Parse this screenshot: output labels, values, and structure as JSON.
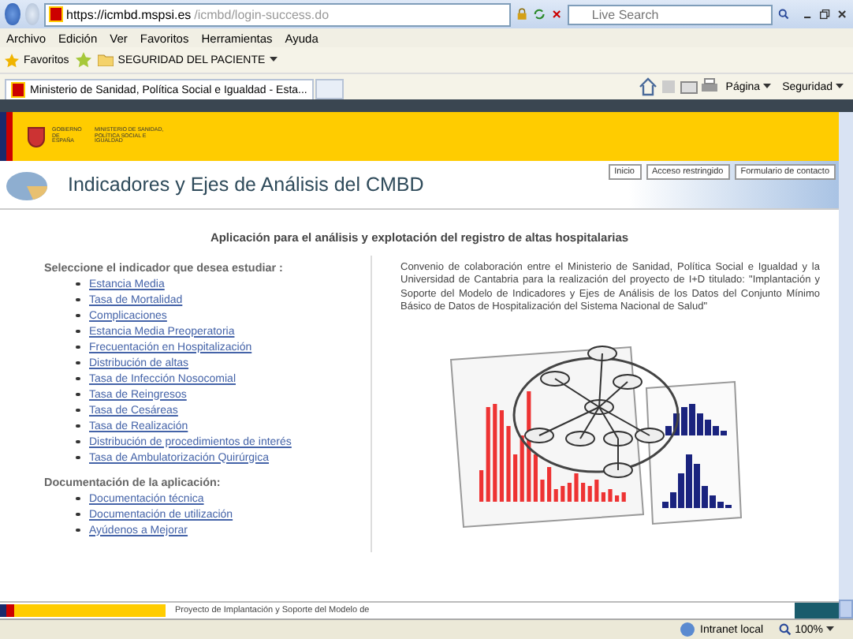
{
  "browser": {
    "url_host": "https://icmbd.mspsi.es",
    "url_path": "/icmbd/login-success.do",
    "search_placeholder": "Live Search",
    "menu": [
      "Archivo",
      "Edición",
      "Ver",
      "Favoritos",
      "Herramientas",
      "Ayuda"
    ],
    "favorites_label": "Favoritos",
    "favorites_folder": "SEGURIDAD DEL PACIENTE",
    "tabs": [
      {
        "label": "Ministerio de Sanidad, Política Social e Igualdad - Esta...",
        "selected": true
      }
    ],
    "commands": [
      "Página",
      "Seguridad"
    ]
  },
  "page": {
    "gov_logo": "GOBIERNO DE ESPAÑA",
    "ministry": "MINISTERIO DE SANIDAD, POLÍTICA SOCIAL E IGUALDAD",
    "nav": [
      "Inicio",
      "Acceso restringido",
      "Formulario de contacto"
    ],
    "site_title": "Indicadores y Ejes de Análisis del CMBD",
    "heading": "Aplicación para el análisis y explotación del registro de altas hospitalarias",
    "indicators_title": "Seleccione el indicador que desea estudiar :",
    "indicators": [
      "Estancia Media",
      "Tasa de Mortalidad",
      "Complicaciones",
      "Estancia Media Preoperatoria",
      "Frecuentación en Hospitalización",
      "Distribución de altas",
      "Tasa de Infección Nosocomial",
      "Tasa de Reingresos",
      "Tasa de Cesáreas",
      "Tasa de Realización",
      "Distribución de procedimientos de interés",
      "Tasa de Ambulatorización Quirúrgica"
    ],
    "docs_title": "Documentación de la aplicación:",
    "docs": [
      "Documentación técnica",
      "Documentación de utilización",
      "Ayúdenos a Mejorar"
    ],
    "description": "Convenio de colaboración entre el Ministerio de Sanidad, Política Social e Igualdad y la Universidad de Cantabria para la realización del proyecto de I+D titulado: \"Implantación y Soporte del Modelo de Indicadores y Ejes de Análisis de los Datos del Conjunto Mínimo Básico de Datos de Hospitalización del Sistema Nacional de Salud\"",
    "footer_text": "Proyecto de Implantación y Soporte del Modelo de"
  },
  "status_bar": {
    "zone": "Intranet local",
    "zoom": "100%"
  }
}
